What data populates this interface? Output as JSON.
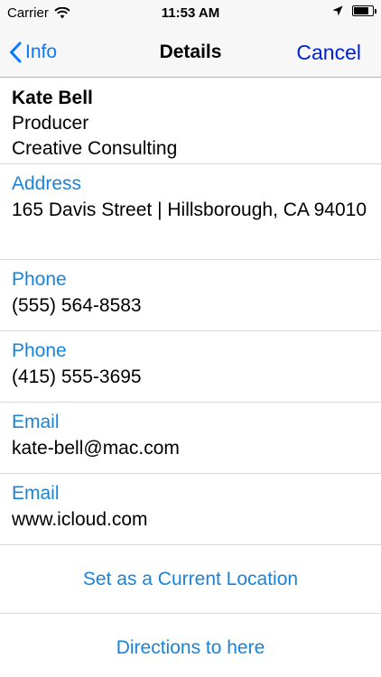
{
  "status_bar": {
    "carrier": "Carrier",
    "time": "11:53 AM",
    "battery_level": 0.85
  },
  "nav": {
    "back_label": "Info",
    "title": "Details",
    "cancel_label": "Cancel"
  },
  "contact": {
    "name": "Kate Bell",
    "job_title": "Producer",
    "company": "Creative Consulting"
  },
  "fields": {
    "address": {
      "label": "Address",
      "value": "165 Davis Street | Hillsborough, CA 94010"
    },
    "phone1": {
      "label": "Phone",
      "value": "(555) 564-8583"
    },
    "phone2": {
      "label": "Phone",
      "value": "(415) 555-3695"
    },
    "email1": {
      "label": "Email",
      "value": "kate-bell@mac.com"
    },
    "email2": {
      "label": "Email",
      "value": "www.icloud.com"
    }
  },
  "actions": {
    "set_location": "Set as a Current Location",
    "directions": "Directions to here"
  },
  "colors": {
    "accent": "#1a83d9",
    "cancel": "#0022d4"
  }
}
